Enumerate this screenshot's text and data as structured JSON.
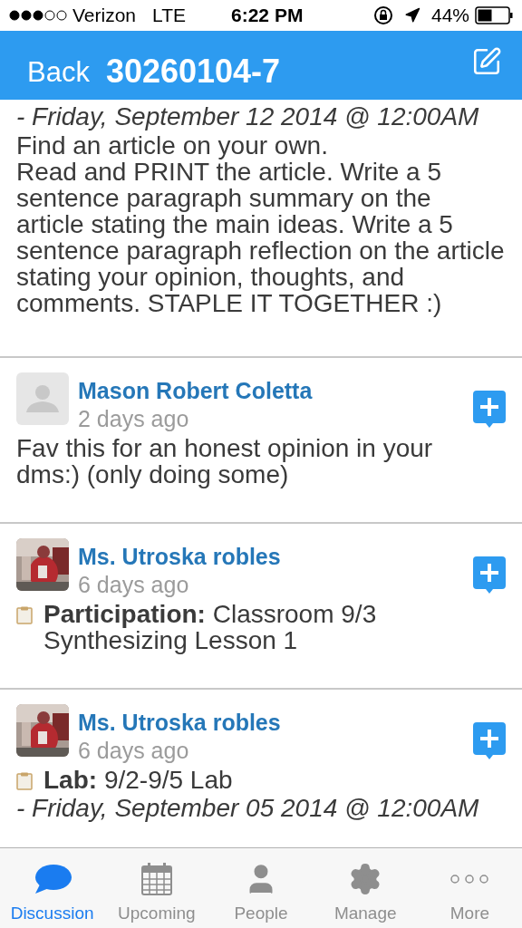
{
  "status_bar": {
    "carrier": "Verizon",
    "network": "LTE",
    "time": "6:22 PM",
    "battery": "44%"
  },
  "nav": {
    "back": "Back",
    "title": "30260104-7"
  },
  "posts": [
    {
      "kind": "continued",
      "due": "- Friday, September 12 2014 @ 12:00AM",
      "body": "Find an article on your own.\nRead and PRINT the article. Write a 5 sentence paragraph summary on the article stating the main ideas. Write a 5 sentence paragraph reflection on the article stating your opinion, thoughts, and comments. STAPLE IT TOGETHER :)"
    },
    {
      "kind": "message",
      "author": "Mason Robert Coletta",
      "time": "2 days ago",
      "body": "Fav this for an honest opinion in your dms:) (only doing some)"
    },
    {
      "kind": "assignment",
      "author": "Ms. Utroska robles",
      "time": "6 days ago",
      "body": "**Participation:** Classroom 9/3 Synthesizing Lesson 1"
    },
    {
      "kind": "assignment",
      "author": "Ms. Utroska robles",
      "time": "6 days ago",
      "body": "**Lab:** 9/2-9/5 Lab",
      "due": "- Friday, September 05 2014 @ 12:00AM"
    }
  ],
  "tabs": [
    {
      "label": "Discussion",
      "selected": true
    },
    {
      "label": "Upcoming",
      "selected": false
    },
    {
      "label": "People",
      "selected": false
    },
    {
      "label": "Manage",
      "selected": false
    },
    {
      "label": "More",
      "selected": false
    }
  ]
}
